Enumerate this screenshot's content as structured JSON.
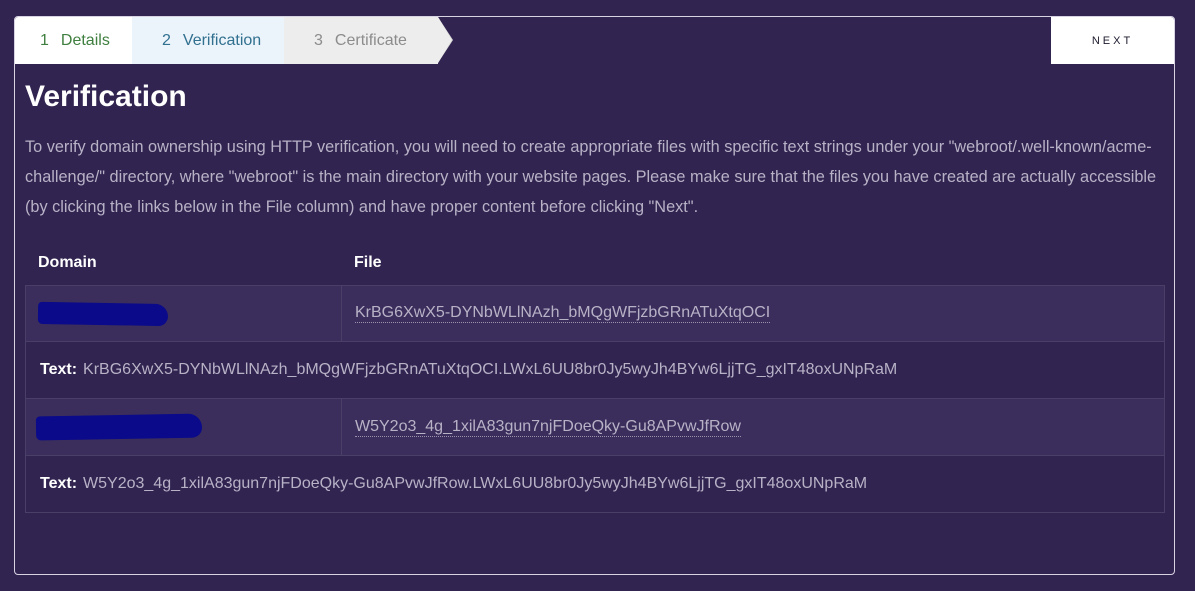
{
  "steps": [
    {
      "number": "1",
      "label": "Details"
    },
    {
      "number": "2",
      "label": "Verification"
    },
    {
      "number": "3",
      "label": "Certificate"
    }
  ],
  "toolbar": {
    "next_label": "NEXT"
  },
  "page": {
    "title": "Verification",
    "description": "To verify domain ownership using HTTP verification, you will need to create appropriate files with specific text strings under your \"webroot/.well-known/acme-challenge/\" directory, where \"webroot\" is the main directory with your website pages. Please make sure that the files you have created are actually accessible (by clicking the links below in the File column) and have proper content before clicking \"Next\"."
  },
  "table": {
    "headers": {
      "domain": "Domain",
      "file": "File"
    },
    "text_label": "Text:",
    "rows": [
      {
        "file": "KrBG6XwX5-DYNbWLlNAzh_bMQgWFjzbGRnATuXtqOCI",
        "text": "KrBG6XwX5-DYNbWLlNAzh_bMQgWFjzbGRnATuXtqOCI.LWxL6UU8br0Jy5wyJh4BYw6LjjTG_gxIT48oxUNpRaM"
      },
      {
        "file": "W5Y2o3_4g_1xilA83gun7njFDoeQky-Gu8APvwJfRow",
        "text": "W5Y2o3_4g_1xilA83gun7njFDoeQky-Gu8APvwJfRow.LWxL6UU8br0Jy5wyJh4BYw6LjjTG_gxIT48oxUNpRaM"
      }
    ]
  },
  "colors": {
    "background": "#312450",
    "step_done": "#3f7f3f",
    "step_active": "#31708f",
    "step_pending": "#8c8c8c",
    "redaction": "#0a0a8a"
  }
}
